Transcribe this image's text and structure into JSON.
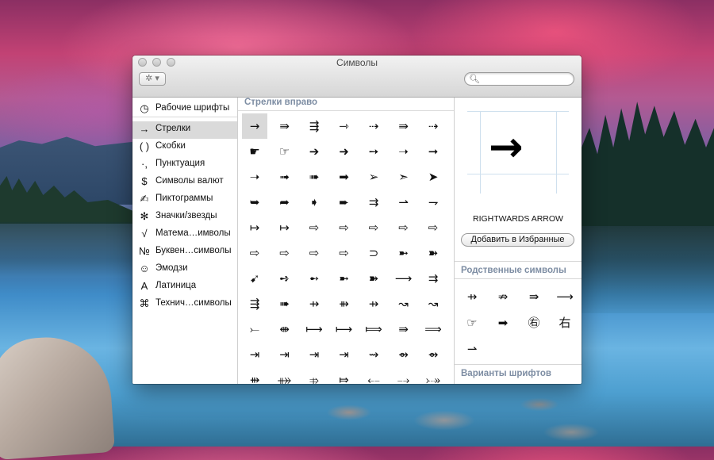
{
  "window": {
    "title": "Символы"
  },
  "toolbar": {
    "gear_icon": "✲",
    "search_placeholder": "",
    "search_value": ""
  },
  "sidebar": {
    "items": [
      {
        "icon": "◷",
        "label": "Рабочие шрифты"
      },
      {
        "icon": "→",
        "label": "Стрелки"
      },
      {
        "icon": "( )",
        "label": "Скобки"
      },
      {
        "icon": "·,",
        "label": "Пунктуация"
      },
      {
        "icon": "$",
        "label": "Символы валют"
      },
      {
        "icon": "✍",
        "label": "Пиктограммы"
      },
      {
        "icon": "✻",
        "label": "Значки/звезды"
      },
      {
        "icon": "√",
        "label": "Матема…имволы"
      },
      {
        "icon": "№",
        "label": "Буквен…символы"
      },
      {
        "icon": "☺",
        "label": "Эмодзи"
      },
      {
        "icon": "A",
        "label": "Латиница"
      },
      {
        "icon": "⌘",
        "label": "Технич…символы"
      }
    ],
    "selected_index": 1
  },
  "grid": {
    "header": "Стрелки вправо",
    "rows": [
      [
        "→",
        "⇛",
        "⇶",
        "⇾",
        "⇢",
        "⇛",
        "⇢"
      ],
      [
        "☛",
        "☞",
        "➔",
        "➜",
        "➙",
        "➝",
        "➞"
      ],
      [
        "➝",
        "➟",
        "➠",
        "➡",
        "➢",
        "➣",
        "➤"
      ],
      [
        "➥",
        "➦",
        "➧",
        "➨",
        "⇉",
        "⇀",
        "⇁"
      ],
      [
        "↦",
        "↦",
        "⇨",
        "⇨",
        "⇨",
        "⇨",
        "⇨"
      ],
      [
        "⇨",
        "⇨",
        "⇨",
        "⇨",
        "⊃",
        "➼",
        "➽"
      ],
      [
        "➹",
        "➺",
        "➻",
        "➼",
        "➽",
        "⟶",
        "⇉"
      ],
      [
        "⇶",
        "➠",
        "⇸",
        "⇻",
        "⇸",
        "↝",
        "↝"
      ],
      [
        "⤚",
        "⇼",
        "⟼",
        "⟼",
        "⟾",
        "⇛",
        "⟹"
      ],
      [
        "⇥",
        "⇥",
        "⇥",
        "⇥",
        "⇝",
        "⇴",
        "⇴"
      ],
      [
        "⇻",
        "⤁",
        "⤃",
        "⤇",
        "⤌",
        "⤍",
        "⤐"
      ]
    ],
    "selected": {
      "row": 0,
      "col": 0
    }
  },
  "detail": {
    "preview_char": "→",
    "char_name": "RIGHTWARDS ARROW",
    "favorite_button": "Добавить в Избранные",
    "related_title": "Родственные символы",
    "related": [
      "⇸",
      "⇏",
      "⇛",
      "⟶",
      "☞",
      "➡",
      "㊨",
      "右",
      "⇀"
    ],
    "font_variants_title": "Варианты шрифтов"
  }
}
